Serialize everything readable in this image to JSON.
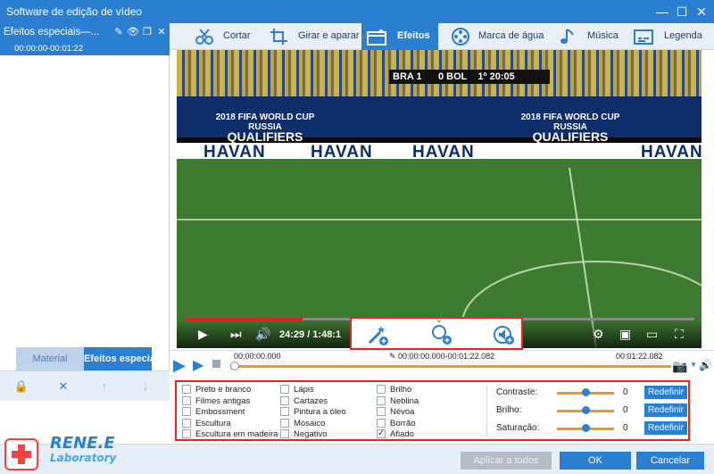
{
  "window": {
    "title": "Software de edição de vídeo",
    "minimize": "—",
    "maximize": "☐",
    "close": "✕"
  },
  "left_panel": {
    "header_label": "Efeitos especiais—...",
    "time_range": "00:00:00-00:01:22",
    "tabs": [
      {
        "label": "Material"
      },
      {
        "label": "Efeitos especiais"
      }
    ]
  },
  "toolbar": {
    "tools": [
      {
        "label": "Cortar"
      },
      {
        "label": "Girar e aparar"
      },
      {
        "label": "Efeitos"
      },
      {
        "label": "Marca de água"
      },
      {
        "label": "Música"
      },
      {
        "label": "Legenda"
      }
    ]
  },
  "video": {
    "score": {
      "team_a": "BRA",
      "score_a": "1",
      "score_b": "0",
      "team_b": "BOL",
      "clock": "1º 20:05"
    },
    "banner_text": [
      "2018 FIFA WORLD CUP RUSSIA",
      "QUALIFIERS"
    ],
    "sponsor": "HAVAN",
    "player_time": "24:29 / 1:48:1",
    "progress": 0.23
  },
  "timeline": {
    "start": "00:00:00.000",
    "range": "00:00:00.000-00:01:22.082",
    "end": "00:01:22.082"
  },
  "effects": {
    "columns": [
      [
        {
          "label": "Preto e branco",
          "checked": false
        },
        {
          "label": "Filmes antigas",
          "checked": false
        },
        {
          "label": "Embossment",
          "checked": false
        },
        {
          "label": "Escultura",
          "checked": false
        },
        {
          "label": "Escultura em madeira",
          "checked": false
        }
      ],
      [
        {
          "label": "Lápis",
          "checked": false
        },
        {
          "label": "Cartazes",
          "checked": false
        },
        {
          "label": "Pintura a óleo",
          "checked": false
        },
        {
          "label": "Mosaico",
          "checked": false
        },
        {
          "label": "Negativo",
          "checked": false
        }
      ],
      [
        {
          "label": "Brilho",
          "checked": false
        },
        {
          "label": "Neblina",
          "checked": false
        },
        {
          "label": "Névoa",
          "checked": false
        },
        {
          "label": "Borrão",
          "checked": false
        },
        {
          "label": "Afiado",
          "checked": true
        }
      ]
    ],
    "sliders": [
      {
        "label": "Contraste:",
        "value": "0",
        "reset": "Redefinir",
        "level": 0.5
      },
      {
        "label": "Brilho:",
        "value": "0",
        "reset": "Redefinir",
        "level": 0.5
      },
      {
        "label": "Saturação:",
        "value": "0",
        "reset": "Redefinir",
        "level": 0.5
      }
    ]
  },
  "bottom": {
    "brand": "RENE.E",
    "brand_sub": "Laboratory",
    "apply_all": "Aplicar a todos",
    "ok": "OK",
    "cancel": "Cancelar"
  },
  "colors": {
    "accent": "#2b7fd0",
    "orange": "#f7941d",
    "highlight": "#e22222"
  }
}
